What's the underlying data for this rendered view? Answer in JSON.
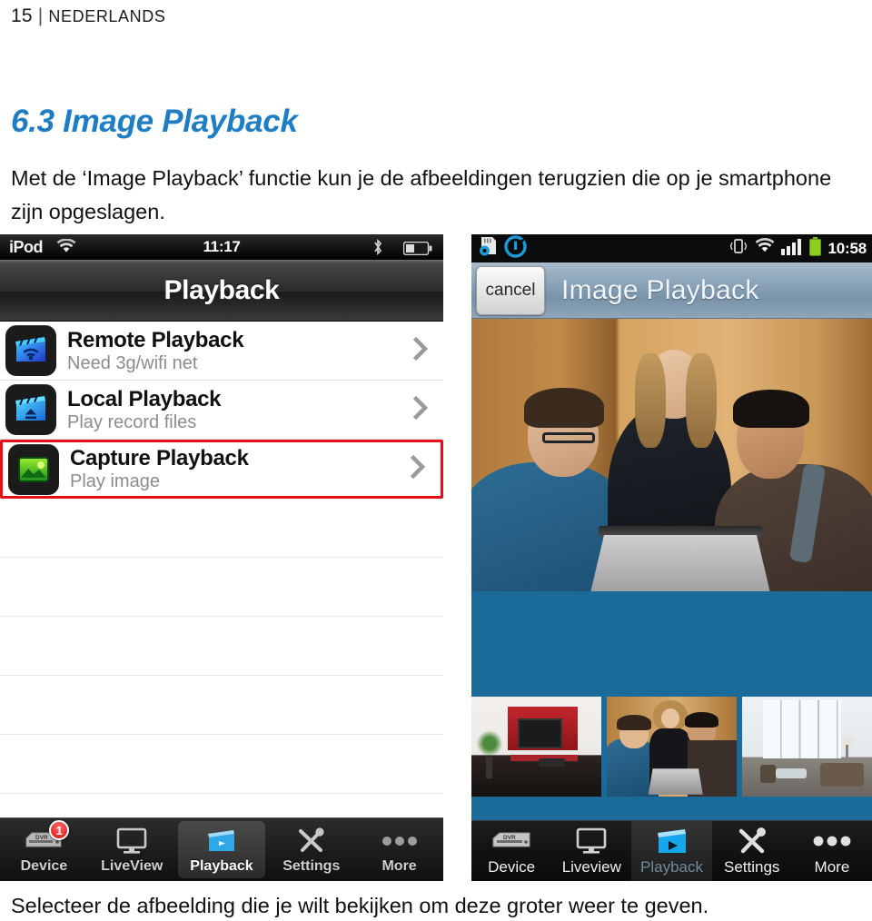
{
  "document": {
    "page_number": "15",
    "separator": "|",
    "language": "NEDERLANDS",
    "section_title": "6.3 Image Playback",
    "intro_paragraph": "Met de ‘Image Playback’ functie kun je de afbeeldingen terugzien die op je smartphone zijn opgeslagen.",
    "caption": "Selecteer de afbeelding die je wilt bekijken om deze groter weer te geven.",
    "accent_color": "#1f7dc4",
    "highlight_color": "#e2101a"
  },
  "ios_phone": {
    "status_bar": {
      "carrier": "iPod",
      "wifi_icon": "wifi-icon",
      "time": "11:17",
      "bluetooth_icon": "bluetooth-icon",
      "battery_icon": "battery-icon"
    },
    "navbar": {
      "title": "Playback"
    },
    "list": [
      {
        "title": "Remote Playback",
        "subtitle": "Need 3g/wifi net",
        "icon": "clapperboard-wifi-icon",
        "chevron": "chevron-right-icon",
        "highlighted": false
      },
      {
        "title": "Local Playback",
        "subtitle": "Play record files",
        "icon": "clapperboard-eject-icon",
        "chevron": "chevron-right-icon",
        "highlighted": false
      },
      {
        "title": "Capture Playback",
        "subtitle": "Play image",
        "icon": "photo-landscape-icon",
        "chevron": "chevron-right-icon",
        "highlighted": true
      }
    ],
    "empty_rows": 5,
    "tabbar": [
      {
        "label": "Device",
        "icon": "dvr-icon",
        "badge": "1",
        "active": false
      },
      {
        "label": "LiveView",
        "icon": "monitor-icon",
        "badge": "",
        "active": false
      },
      {
        "label": "Playback",
        "icon": "clapperboard-play-icon",
        "badge": "",
        "active": true
      },
      {
        "label": "Settings",
        "icon": "tools-icon",
        "badge": "",
        "active": false
      },
      {
        "label": "More",
        "icon": "ellipsis-icon",
        "badge": "",
        "active": false
      }
    ]
  },
  "android_phone": {
    "status_bar": {
      "sdcard_icon": "sdcard-settings-icon",
      "app_icon": "c-logo-icon",
      "vibrate_icon": "vibrate-icon",
      "wifi_icon": "wifi-icon",
      "signal_icon": "signal-bars-icon",
      "battery_icon": "battery-full-icon",
      "time": "10:58"
    },
    "actionbar": {
      "cancel_label": "cancel",
      "title": "Image Playback"
    },
    "main_image": {
      "alt": "Three people looking at a laptop in front of a wooden wall",
      "background_color": "#1a6b9a"
    },
    "thumbnails": [
      {
        "alt": "Red living room with wall-mounted TV"
      },
      {
        "alt": "Three people looking at a laptop"
      },
      {
        "alt": "Bright room with large windows and sofa"
      }
    ],
    "tabbar": [
      {
        "label": "Device",
        "icon": "dvr-icon",
        "active": false
      },
      {
        "label": "Liveview",
        "icon": "monitor-icon",
        "active": false
      },
      {
        "label": "Playback",
        "icon": "clapperboard-play-icon",
        "active": true
      },
      {
        "label": "Settings",
        "icon": "tools-icon",
        "active": false
      },
      {
        "label": "More",
        "icon": "ellipsis-icon",
        "active": false
      }
    ]
  }
}
